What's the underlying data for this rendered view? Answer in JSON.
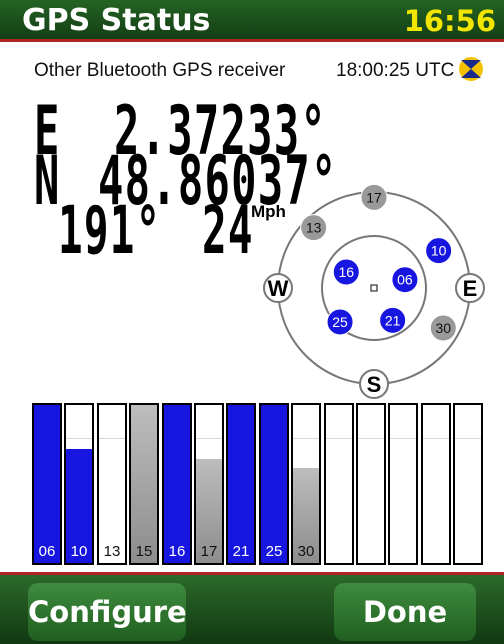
{
  "header": {
    "title": "GPS Status",
    "clock": "16:56",
    "accent_color": "#f2e600",
    "bar_color": "#1f5a1f",
    "rule_color": "#b22323"
  },
  "receiver": {
    "name": "Other Bluetooth GPS receiver",
    "utc_time": "18:00:25 UTC",
    "status_icon": "gps-fix-icon"
  },
  "position": {
    "lon_dir": "E",
    "lon_value": "2.37233°",
    "lat_dir": "N",
    "lat_value": "48.86037°",
    "heading": "191°",
    "speed": "24",
    "speed_unit": "Mph"
  },
  "skyplot": {
    "compass": [
      "W",
      "E",
      "S"
    ],
    "satellites": [
      {
        "id": "17",
        "used": false,
        "azimuth": 0,
        "elevation": 5
      },
      {
        "id": "13",
        "used": false,
        "azimuth": 315,
        "elevation": 10
      },
      {
        "id": "10",
        "used": true,
        "azimuth": 60,
        "elevation": 20
      },
      {
        "id": "16",
        "used": true,
        "azimuth": 300,
        "elevation": 60
      },
      {
        "id": "06",
        "used": true,
        "azimuth": 75,
        "elevation": 60
      },
      {
        "id": "21",
        "used": true,
        "azimuth": 150,
        "elevation": 55
      },
      {
        "id": "25",
        "used": true,
        "azimuth": 225,
        "elevation": 45
      },
      {
        "id": "30",
        "used": false,
        "azimuth": 120,
        "elevation": 15
      }
    ]
  },
  "signals": [
    {
      "id": "06",
      "used": true,
      "level": 1.0
    },
    {
      "id": "10",
      "used": true,
      "level": 0.72
    },
    {
      "id": "13",
      "used": false,
      "level": 0.0
    },
    {
      "id": "15",
      "used": false,
      "level": 1.0
    },
    {
      "id": "16",
      "used": true,
      "level": 1.0
    },
    {
      "id": "17",
      "used": false,
      "level": 0.66
    },
    {
      "id": "21",
      "used": true,
      "level": 1.0
    },
    {
      "id": "25",
      "used": true,
      "level": 1.0
    },
    {
      "id": "30",
      "used": false,
      "level": 0.6
    },
    {
      "id": "",
      "used": false,
      "level": 0.0
    },
    {
      "id": "",
      "used": false,
      "level": 0.0
    },
    {
      "id": "",
      "used": false,
      "level": 0.0
    },
    {
      "id": "",
      "used": false,
      "level": 0.0
    },
    {
      "id": "",
      "used": false,
      "level": 0.0
    }
  ],
  "colors": {
    "used": "#1616e0",
    "unused": "#999999"
  },
  "buttons": {
    "configure": "Configure",
    "done": "Done"
  }
}
